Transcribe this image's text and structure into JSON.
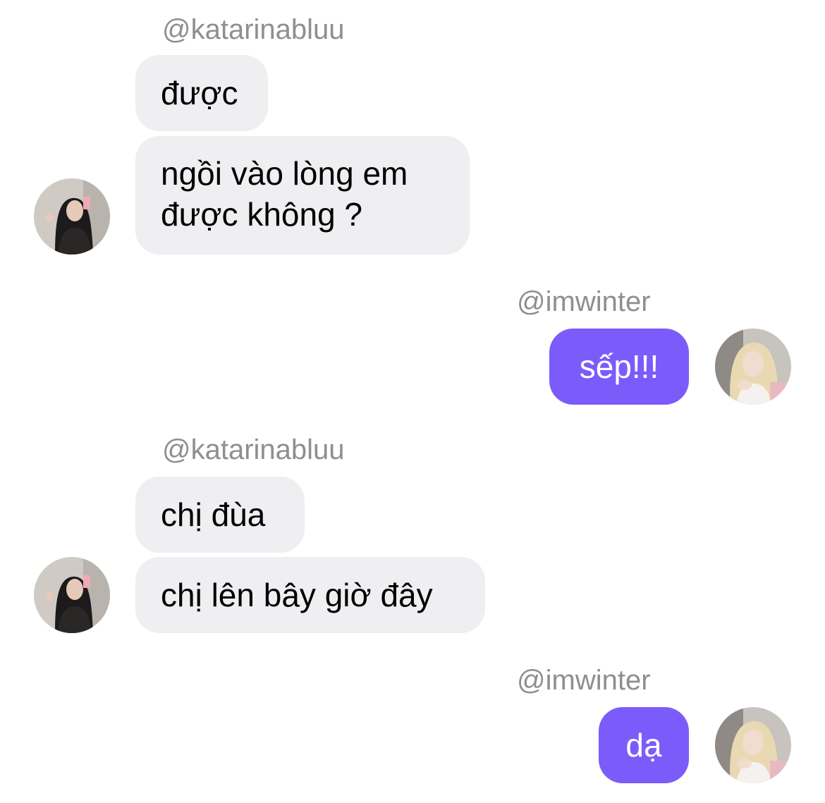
{
  "colors": {
    "incoming_bubble": "#efeff2",
    "outgoing_bubble": "#7b5cfa",
    "username_text": "#8e8e93"
  },
  "messages": [
    {
      "username": "@katarinabluu",
      "direction": "incoming",
      "bubbles": [
        "được",
        "ngồi vào lòng em được không ?"
      ],
      "avatar": "katarinabluu-avatar"
    },
    {
      "username": "@imwinter",
      "direction": "outgoing",
      "bubbles": [
        "sếp!!!"
      ],
      "avatar": "imwinter-avatar"
    },
    {
      "username": "@katarinabluu",
      "direction": "incoming",
      "bubbles": [
        "chị đùa",
        "chị lên bây giờ đây"
      ],
      "avatar": "katarinabluu-avatar"
    },
    {
      "username": "@imwinter",
      "direction": "outgoing",
      "bubbles": [
        "dạ"
      ],
      "avatar": "imwinter-avatar"
    }
  ]
}
